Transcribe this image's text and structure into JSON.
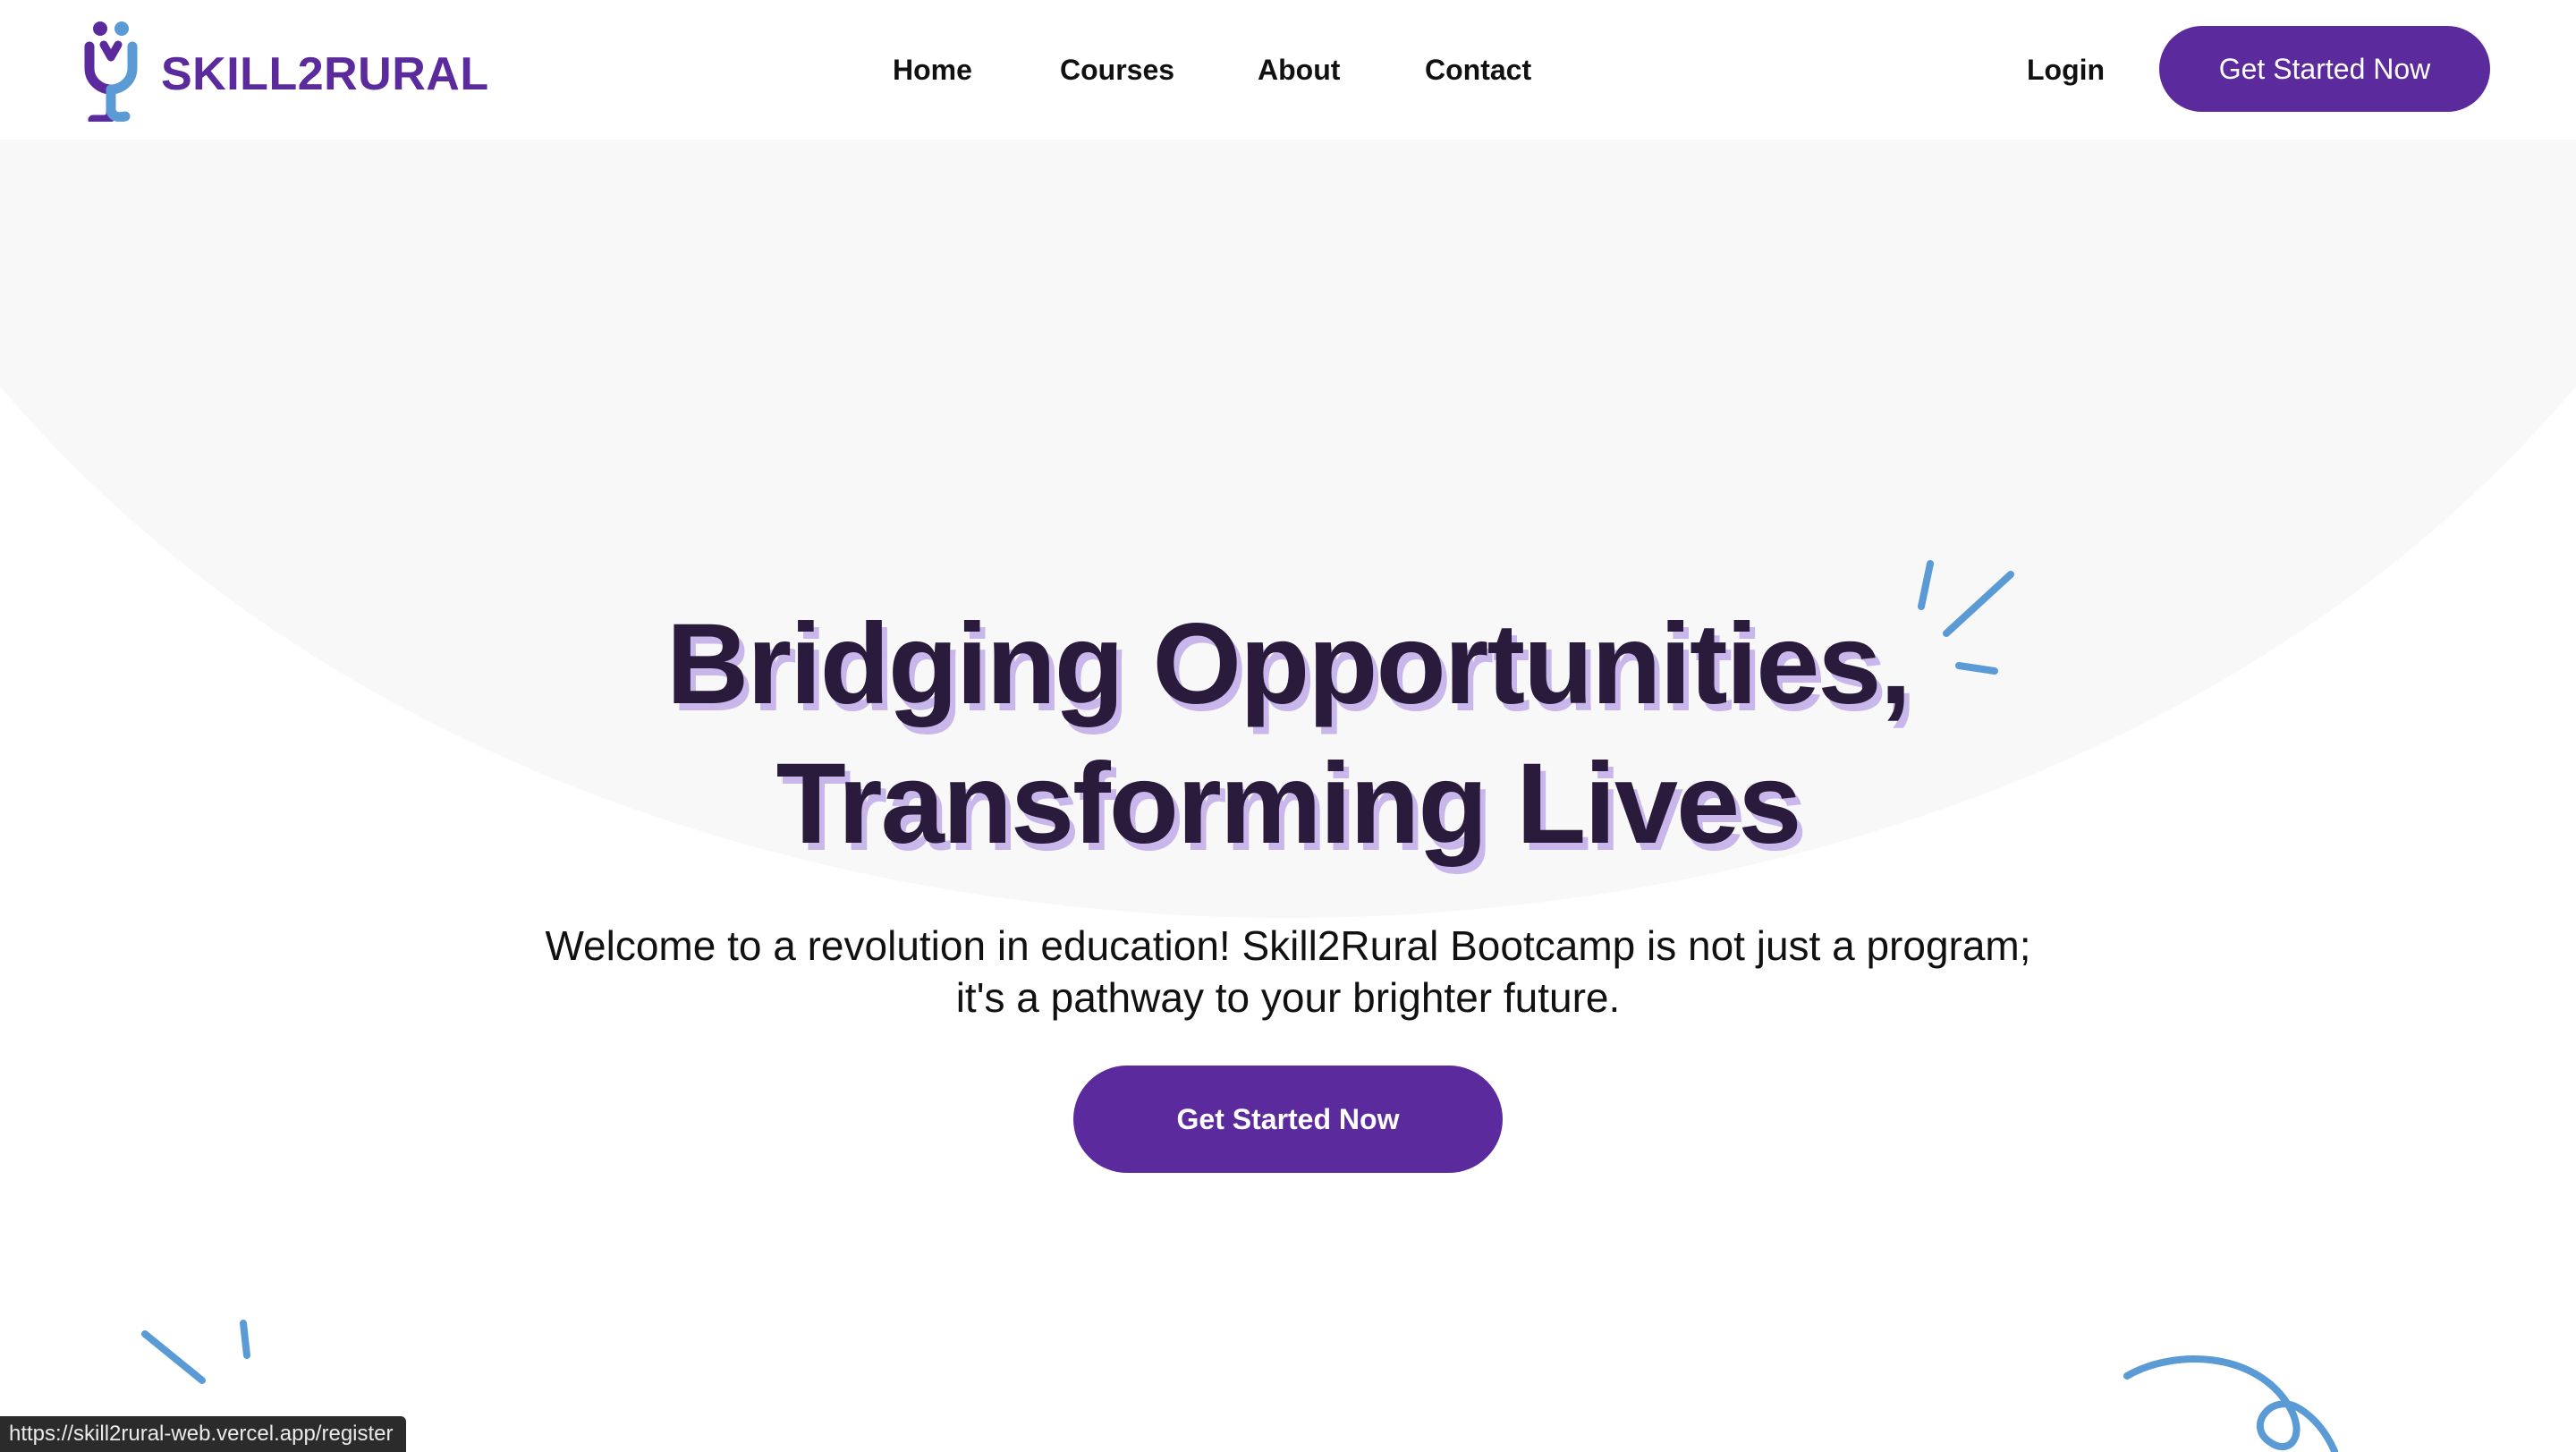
{
  "brand": {
    "name": "SKILL2RURAL",
    "primary_color": "#5b2a9c",
    "secondary_color": "#5b9bd5"
  },
  "nav": {
    "items": [
      {
        "label": "Home"
      },
      {
        "label": "Courses"
      },
      {
        "label": "About"
      },
      {
        "label": "Contact"
      }
    ],
    "login_label": "Login",
    "cta_label": "Get Started Now"
  },
  "hero": {
    "title_line1": "Bridging Opportunities,",
    "title_line2": "Transforming Lives",
    "subtitle_line1": "Welcome to a revolution in education! Skill2Rural Bootcamp is not just a program;",
    "subtitle_line2": "it's a pathway to your brighter future.",
    "cta_label": "Get Started Now",
    "background_color": "#f8f8f8",
    "title_shadow_color": "#c9b6ea"
  },
  "status_bar": {
    "url": "https://skill2rural-web.vercel.app/register"
  },
  "icons": {
    "logo": "skill2rural-logo-icon",
    "sparkle": "sparkle-icon",
    "squiggle": "squiggle-icon"
  }
}
